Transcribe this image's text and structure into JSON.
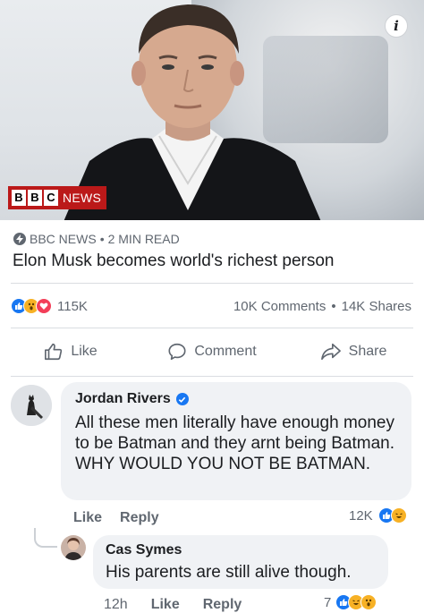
{
  "post": {
    "source_logo_text": "NEWS",
    "source_logo_letters": [
      "B",
      "B",
      "C"
    ],
    "meta_source": "BBC NEWS",
    "meta_sep": "•",
    "meta_read": "2 MIN READ",
    "headline": "Elon Musk becomes world's richest person"
  },
  "reactions": {
    "count": "115K",
    "comments": "10K Comments",
    "sep": "•",
    "shares": "14K Shares"
  },
  "actions": {
    "like": "Like",
    "comment": "Comment",
    "share": "Share"
  },
  "comments": [
    {
      "name": "Jordan Rivers",
      "verified": true,
      "text": "All these men literally have enough money to be Batman and they arnt being Batman. WHY WOULD YOU NOT BE BATMAN.",
      "like_label": "Like",
      "reply_label": "Reply",
      "reaction_count": "12K"
    }
  ],
  "replies": [
    {
      "name": "Cas Symes",
      "text": "His parents are still alive though.",
      "time": "12h",
      "like_label": "Like",
      "reply_label": "Reply",
      "reaction_count": "7"
    }
  ],
  "colors": {
    "facebook_blue": "#1877f2",
    "bbc_red": "#bb1919",
    "bubble_gray": "#f0f2f5",
    "muted_text": "#606770"
  }
}
